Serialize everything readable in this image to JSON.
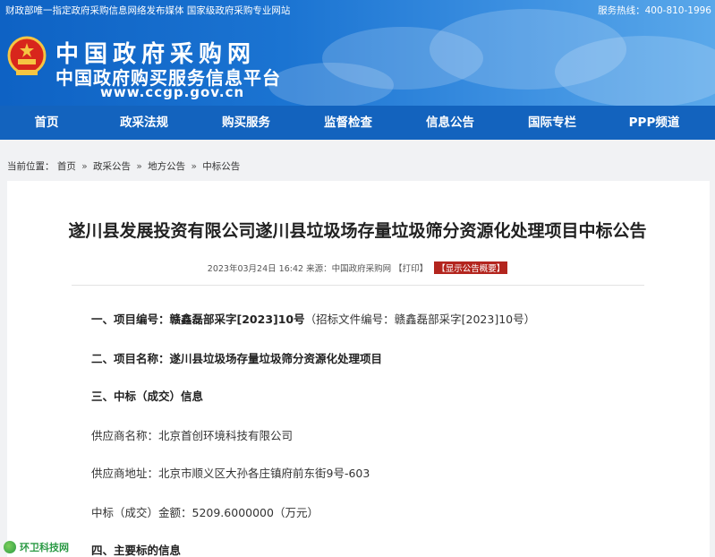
{
  "header": {
    "tagline_left": "财政部唯一指定政府采购信息网络发布媒体  国家级政府采购专业网站",
    "hotline": "服务热线：400-810-1996",
    "logo_title": "中国政府采购网",
    "logo_subtitle": "中国政府购买服务信息平台",
    "logo_url": "www.ccgp.gov.cn"
  },
  "nav": {
    "items": [
      "首页",
      "政采法规",
      "购买服务",
      "监督检查",
      "信息公告",
      "国际专栏",
      "PPP频道"
    ]
  },
  "breadcrumb": {
    "prefix": "当前位置：",
    "items": [
      "首页",
      "政采公告",
      "地方公告",
      "中标公告"
    ],
    "separator": "»"
  },
  "article": {
    "title": "遂川县发展投资有限公司遂川县垃圾场存量垃圾筛分资源化处理项目中标公告",
    "meta_date": "2023年03月24日 16:42",
    "meta_source": "来源：中国政府采购网",
    "meta_print": "【打印】",
    "meta_badge": "【显示公告概要】",
    "line1_label": "一、项目编号：",
    "line1_value": "赣鑫磊部采字[2023]10号",
    "line1_extra": "（招标文件编号：赣鑫磊部采字[2023]10号）",
    "line2_label": "二、项目名称：",
    "line2_value": "遂川县垃圾场存量垃圾筛分资源化处理项目",
    "line3": "三、中标（成交）信息",
    "line4": "供应商名称：北京首创环境科技有限公司",
    "line5": "供应商地址：北京市顺义区大孙各庄镇府前东街9号-603",
    "line6": "中标（成交）金额：5209.6000000（万元）",
    "line7": "四、主要标的信息"
  },
  "watermark": {
    "text": "环卫科技网"
  },
  "colors": {
    "nav_bg": "#1363be",
    "badge_bg": "#b3251e",
    "watermark": "#2b9a45"
  }
}
